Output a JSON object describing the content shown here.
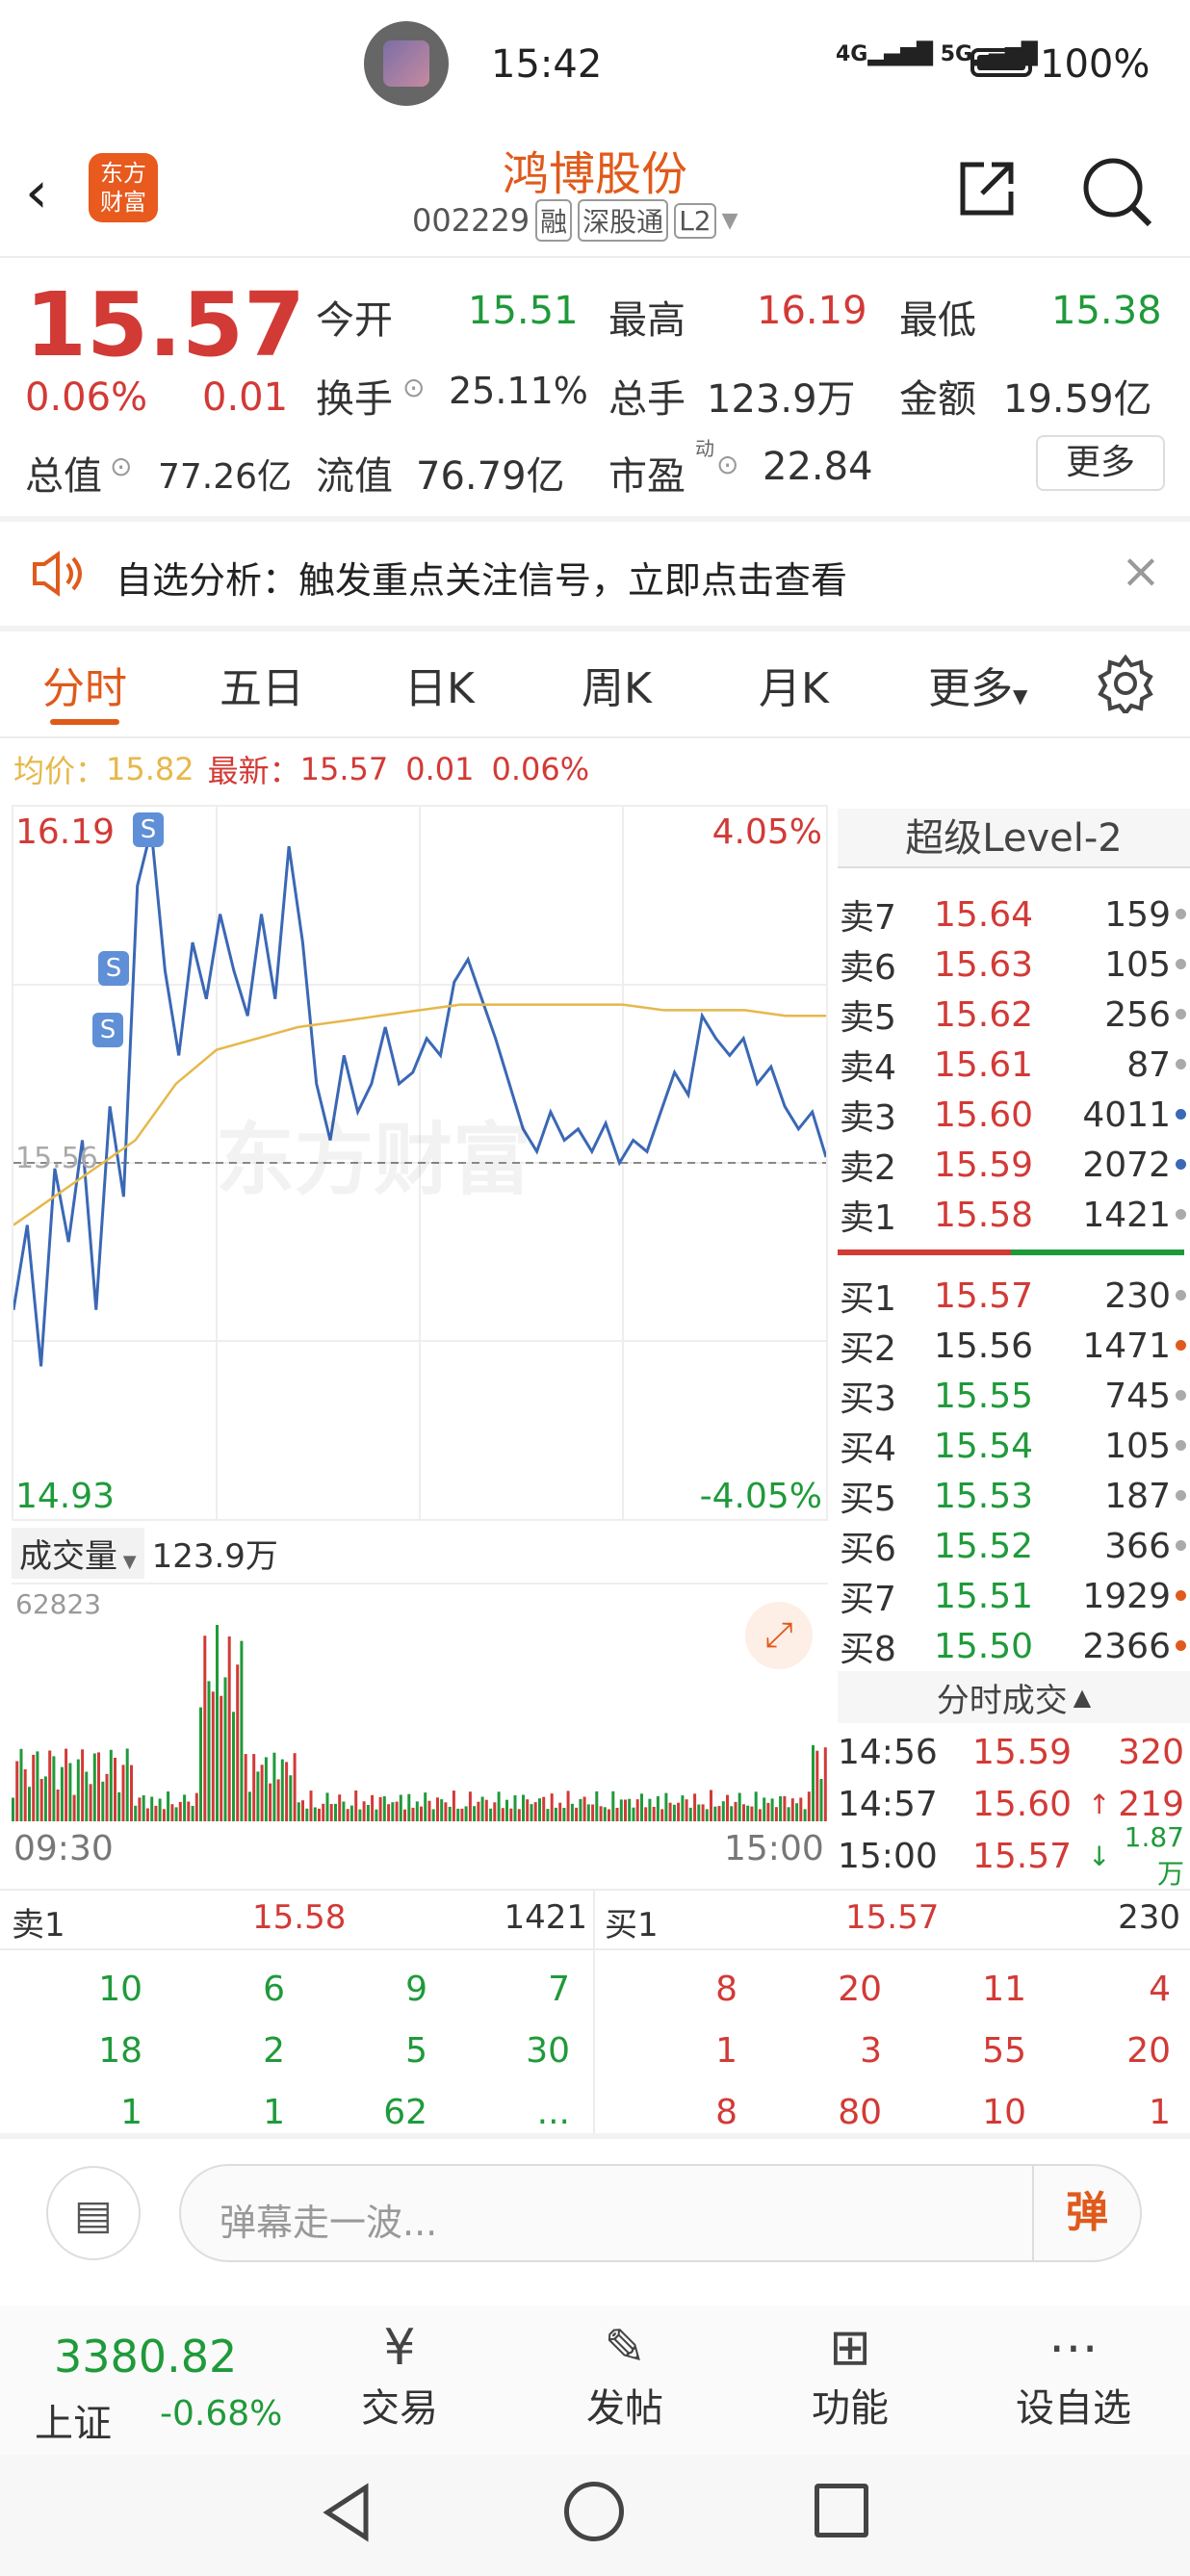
{
  "status_bar": {
    "time": "15:42",
    "network": "4G 5G",
    "battery": "100%"
  },
  "header": {
    "title": "鸿博股份",
    "code": "002229",
    "badges": [
      "融",
      "深股通",
      "L2"
    ],
    "logo_line1": "东方",
    "logo_line2": "财富"
  },
  "quote": {
    "price": "15.57",
    "change_pct": "0.06%",
    "change_abs": "0.01",
    "open_label": "今开",
    "open": "15.51",
    "high_label": "最高",
    "high": "16.19",
    "low_label": "最低",
    "low": "15.38",
    "turnover_label": "换手",
    "turnover": "25.11%",
    "volume_label": "总手",
    "volume": "123.9万",
    "amount_label": "金额",
    "amount": "19.59亿",
    "mktcap_label": "总值",
    "mktcap": "77.26亿",
    "float_label": "流值",
    "float": "76.79亿",
    "pe_label": "市盈",
    "pe_sup": "动",
    "pe": "22.84",
    "more_button": "更多"
  },
  "notice": {
    "text": "自选分析：触发重点关注信号，立即点击查看"
  },
  "tabs": {
    "items": [
      "分时",
      "五日",
      "日K",
      "周K",
      "月K",
      "更多"
    ],
    "active": "分时"
  },
  "chart_info": {
    "avg_label": "均价：",
    "avg": "15.82",
    "latest_label": "最新：",
    "latest": "15.57",
    "chg": "0.01",
    "chg_pct": "0.06%"
  },
  "chart_labels": {
    "top_price": "16.19",
    "top_pct": "4.05%",
    "bottom_price": "14.93",
    "bottom_pct": "-4.05%",
    "mid_price": "15.56",
    "vol_label": "成交量",
    "vol_total": "123.9万",
    "vol_max": "62823",
    "time_start": "09:30",
    "time_end": "15:00",
    "watermark": "东方财富",
    "signal": "S"
  },
  "level2": {
    "title": "超级Level-2",
    "asks": [
      {
        "label": "卖7",
        "price": "15.64",
        "vol": "159",
        "dot": "gray"
      },
      {
        "label": "卖6",
        "price": "15.63",
        "vol": "105",
        "dot": "gray"
      },
      {
        "label": "卖5",
        "price": "15.62",
        "vol": "256",
        "dot": "gray"
      },
      {
        "label": "卖4",
        "price": "15.61",
        "vol": "87",
        "dot": "gray"
      },
      {
        "label": "卖3",
        "price": "15.60",
        "vol": "4011",
        "dot": "blue"
      },
      {
        "label": "卖2",
        "price": "15.59",
        "vol": "2072",
        "dot": "blue"
      },
      {
        "label": "卖1",
        "price": "15.58",
        "vol": "1421",
        "dot": "gray"
      }
    ],
    "bids": [
      {
        "label": "买1",
        "price": "15.57",
        "vol": "230",
        "dot": "gray"
      },
      {
        "label": "买2",
        "price": "15.56",
        "vol": "1471",
        "dot": "orange"
      },
      {
        "label": "买3",
        "price": "15.55",
        "vol": "745",
        "dot": "gray"
      },
      {
        "label": "买4",
        "price": "15.54",
        "vol": "105",
        "dot": "gray"
      },
      {
        "label": "买5",
        "price": "15.53",
        "vol": "187",
        "dot": "gray"
      },
      {
        "label": "买6",
        "price": "15.52",
        "vol": "366",
        "dot": "gray"
      },
      {
        "label": "买7",
        "price": "15.51",
        "vol": "1929",
        "dot": "orange"
      },
      {
        "label": "买8",
        "price": "15.50",
        "vol": "2366",
        "dot": "orange"
      }
    ],
    "ticks_title": "分时成交",
    "ticks": [
      {
        "time": "14:56",
        "price": "15.59",
        "vol": "320",
        "arrow": ""
      },
      {
        "time": "14:57",
        "price": "15.60",
        "vol": "219",
        "arrow": "↑"
      },
      {
        "time": "15:00",
        "price": "15.57",
        "vol": "1.87万",
        "arrow": "↓"
      }
    ]
  },
  "queue": {
    "sell_label": "卖1",
    "sell_price": "15.58",
    "sell_total": "1421",
    "buy_label": "买1",
    "buy_price": "15.57",
    "buy_total": "230",
    "sell_rows": [
      [
        "10",
        "6",
        "9",
        "7"
      ],
      [
        "18",
        "2",
        "5",
        "30"
      ],
      [
        "1",
        "1",
        "62",
        "..."
      ]
    ],
    "buy_rows": [
      [
        "8",
        "20",
        "11",
        "4"
      ],
      [
        "1",
        "3",
        "55",
        "20"
      ],
      [
        "8",
        "80",
        "10",
        "1"
      ]
    ]
  },
  "comment": {
    "placeholder": "弹幕走一波...",
    "danmu_button": "弹"
  },
  "bottom_nav": {
    "index_value": "3380.82",
    "index_name": "上证",
    "index_chg": "-0.68%",
    "items": [
      "交易",
      "发帖",
      "功能",
      "设自选"
    ]
  },
  "colors": {
    "up": "#d23a36",
    "down": "#1f9a3a",
    "accent": "#e05a1b",
    "line": "#3a68b5",
    "avg": "#e6b84a"
  },
  "chart_data": {
    "type": "line",
    "ylim": [
      14.93,
      16.19
    ],
    "prev_close": 15.56,
    "price": [
      15.3,
      15.45,
      15.2,
      15.55,
      15.42,
      15.6,
      15.3,
      15.66,
      15.5,
      16.05,
      16.15,
      15.9,
      15.75,
      15.95,
      15.85,
      16.0,
      15.9,
      15.82,
      16.0,
      15.85,
      16.12,
      15.95,
      15.7,
      15.6,
      15.75,
      15.65,
      15.7,
      15.8,
      15.7,
      15.72,
      15.78,
      15.75,
      15.88,
      15.92,
      15.85,
      15.78,
      15.7,
      15.62,
      15.58,
      15.65,
      15.6,
      15.62,
      15.58,
      15.63,
      15.56,
      15.6,
      15.58,
      15.65,
      15.72,
      15.68,
      15.82,
      15.78,
      15.75,
      15.78,
      15.7,
      15.73,
      15.66,
      15.62,
      15.65,
      15.57
    ],
    "avg": [
      15.45,
      15.5,
      15.55,
      15.6,
      15.7,
      15.76,
      15.78,
      15.8,
      15.81,
      15.82,
      15.83,
      15.84,
      15.84,
      15.84,
      15.84,
      15.84,
      15.83,
      15.83,
      15.83,
      15.82,
      15.82
    ],
    "volume_max": 62823
  }
}
